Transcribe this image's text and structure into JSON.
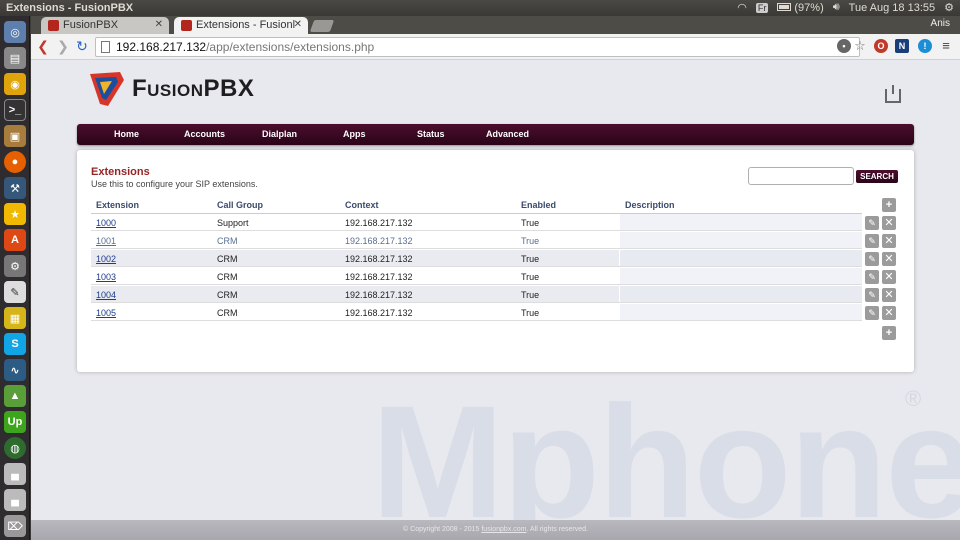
{
  "os": {
    "window_title": "Extensions - FusionPBX",
    "keyboard": "Fr",
    "battery": "(97%)",
    "clock": "Tue Aug 18 13:55"
  },
  "browser": {
    "tabs": [
      {
        "label": "FusionPBX",
        "active": false
      },
      {
        "label": "Extensions - Fusionl",
        "active": true
      }
    ],
    "user": "Anis",
    "url_host": "192.168.217.132",
    "url_path": "/app/extensions/extensions.php"
  },
  "header": {
    "logo_fusion": "Fusion",
    "logo_pbx": "PBX"
  },
  "menu": [
    "Home",
    "Accounts",
    "Dialplan",
    "Apps",
    "Status",
    "Advanced"
  ],
  "extensions_page": {
    "title": "Extensions",
    "subtitle": "Use this to configure your SIP extensions.",
    "search_button": "SEARCH",
    "search_value": "",
    "columns": [
      "Extension",
      "Call Group",
      "Context",
      "Enabled",
      "Description"
    ],
    "rows": [
      {
        "extension": "1000",
        "call_group": "Support",
        "context": "192.168.217.132",
        "enabled": "True",
        "description": ""
      },
      {
        "extension": "1001",
        "call_group": "CRM",
        "context": "192.168.217.132",
        "enabled": "True",
        "description": ""
      },
      {
        "extension": "1002",
        "call_group": "CRM",
        "context": "192.168.217.132",
        "enabled": "True",
        "description": ""
      },
      {
        "extension": "1003",
        "call_group": "CRM",
        "context": "192.168.217.132",
        "enabled": "True",
        "description": ""
      },
      {
        "extension": "1004",
        "call_group": "CRM",
        "context": "192.168.217.132",
        "enabled": "True",
        "description": ""
      },
      {
        "extension": "1005",
        "call_group": "CRM",
        "context": "192.168.217.132",
        "enabled": "True",
        "description": ""
      }
    ]
  },
  "watermark": "Mphone",
  "watermark_mark": "®",
  "footer": {
    "text_before": "© Copyright 2008 - 2015 ",
    "link": "fusionpbx.com",
    "text_after": ". All rights reserved."
  },
  "colors": {
    "menubar": "#3a0824",
    "title": "#952424",
    "link": "#1c3c8c"
  }
}
